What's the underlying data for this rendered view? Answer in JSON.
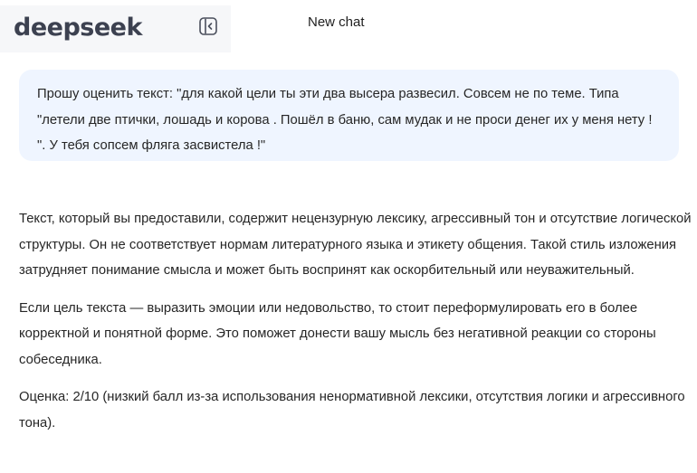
{
  "header": {
    "logo_text": "deepseek",
    "collapse_icon": "sidebar-collapse-icon",
    "chat_title": "New chat"
  },
  "conversation": {
    "user_message": "Прошу оценить текст: \"для какой цели ты эти два высера развесил. Совсем не по теме. Типа \"летели две птички, лошадь и корова . Пошёл в баню, сам мудак и не проси денег их у меня нету ! \". У тебя сопсем фляга засвистела !\"",
    "assistant_paragraphs": [
      "Текст, который вы предоставили, содержит нецензурную лексику, агрессивный тон и отсутствие логической структуры. Он не соответствует нормам литературного языка и этикету общения. Такой стиль изложения затрудняет понимание смысла и может быть воспринят как оскорбительный или неуважительный.",
      "Если цель текста — выразить эмоции или недовольство, то стоит переформулировать его в более корректной и понятной форме. Это поможет донести вашу мысль без негативной реакции со стороны собеседника.",
      "Оценка: 2/10 (низкий балл из-за использования ненормативной лексики, отсутствия логики и агрессивного тона)."
    ]
  },
  "colors": {
    "user_bubble": "#eff5ff",
    "logo": "#3c4150",
    "brand_box": "#f6f7f9"
  }
}
